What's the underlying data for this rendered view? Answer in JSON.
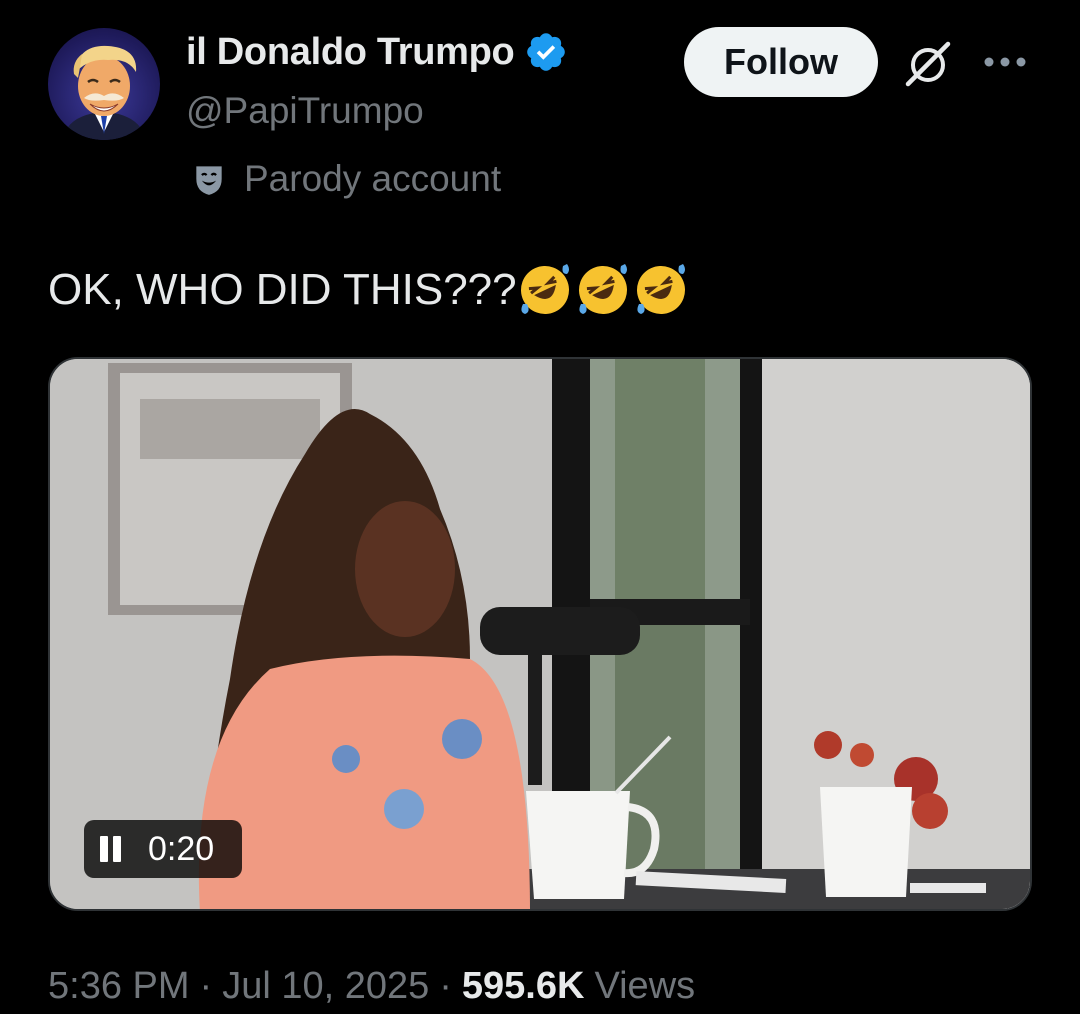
{
  "author": {
    "display_name": "il Donaldo Trumpo",
    "handle": "@PapiTrumpo",
    "verified": true,
    "label": "Parody account",
    "label_icon": "parody-mask-icon"
  },
  "actions": {
    "follow_label": "Follow",
    "grok_icon": "grok-icon",
    "more_icon": "more-icon"
  },
  "tweet": {
    "text": "OK, WHO DID THIS???",
    "emojis": [
      "rolling-on-floor-laughing-emoji",
      "rolling-on-floor-laughing-emoji",
      "rolling-on-floor-laughing-emoji"
    ]
  },
  "video": {
    "elapsed": "0:20",
    "state": "playing"
  },
  "meta": {
    "time": "5:36 PM",
    "separator": "·",
    "date": "Jul 10, 2025",
    "views_count": "595.6K",
    "views_label": "Views"
  },
  "colors": {
    "background": "#000000",
    "primary_text": "#e7e9ea",
    "secondary_text": "#71767b",
    "verified_blue": "#1d9bf0",
    "follow_bg": "#eff3f4"
  }
}
